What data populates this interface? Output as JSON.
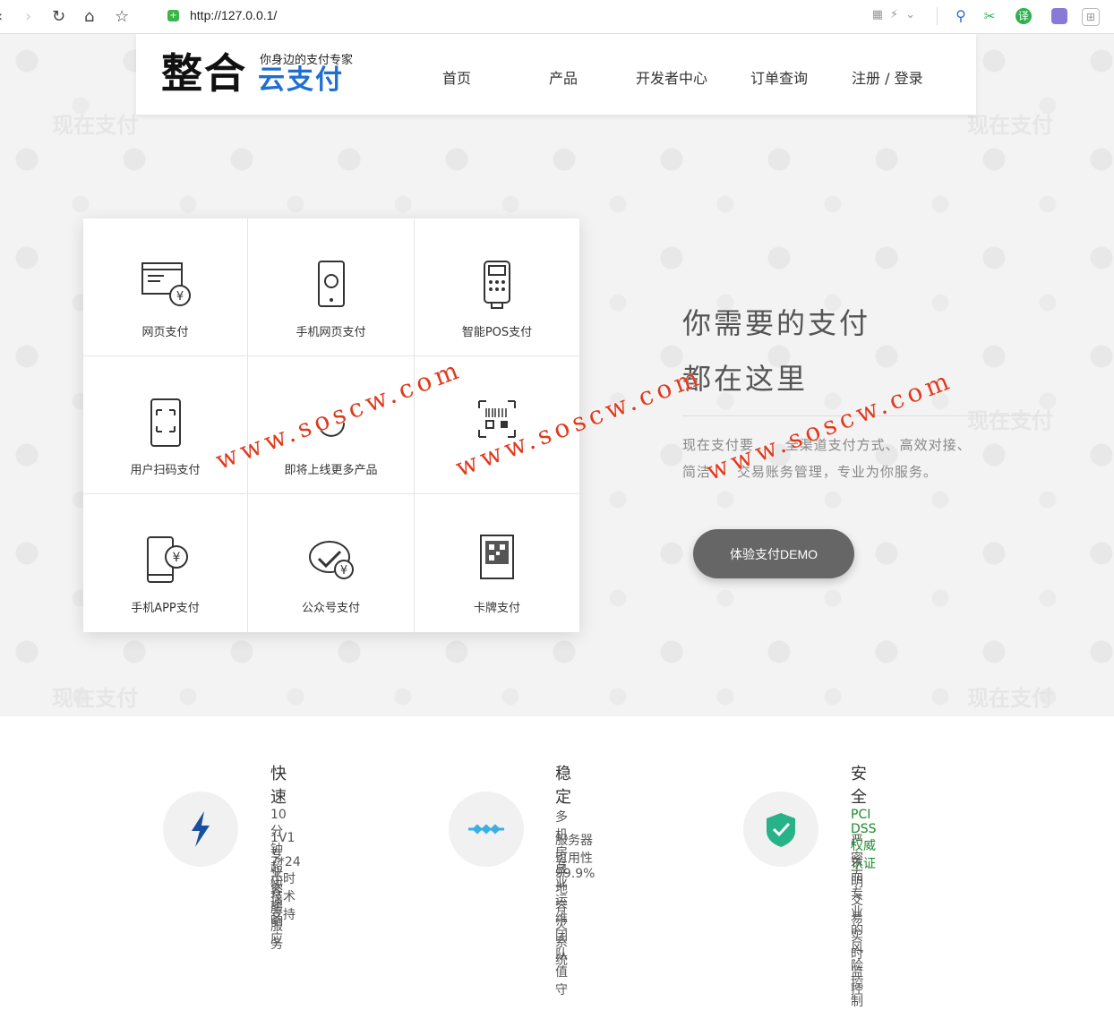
{
  "browser": {
    "url": "http://127.0.0.1/",
    "nav_icons": [
      "back-icon",
      "forward-icon",
      "reload-icon",
      "home-icon",
      "star-icon"
    ],
    "ext_translate_label": "译"
  },
  "site": {
    "logo_main": "整合",
    "logo_sub": "你身边的支付专家",
    "logo_blue": "云支付",
    "nav": [
      "首页",
      "产品",
      "开发者中心",
      "订单查询",
      "注册 / 登录"
    ],
    "brand_color": "#1f6fd0"
  },
  "products": [
    {
      "label": "网页支付",
      "icon": "web-pay-icon"
    },
    {
      "label": "手机网页支付",
      "icon": "mobile-web-pay-icon"
    },
    {
      "label": "智能POS支付",
      "icon": "pos-icon"
    },
    {
      "label": "用户扫码支付",
      "icon": "scan-icon"
    },
    {
      "label": "即将上线更多产品",
      "icon": "more-icon"
    },
    {
      "label": "",
      "icon": "barcode-icon"
    },
    {
      "label": "手机APP支付",
      "icon": "app-pay-icon"
    },
    {
      "label": "公众号支付",
      "icon": "wechat-pay-icon"
    },
    {
      "label": "卡牌支付",
      "icon": "card-pay-icon"
    }
  ],
  "hero": {
    "slogan_line1": "你需要的支付",
    "slogan_line2": "都在这里",
    "desc_line1": "现在支付要      全渠道支付方式、高效对接、",
    "desc_line2": "简洁     交易账务管理，专业为你服务。",
    "demo_button": "体验支付DEMO",
    "bg_logo_text": "现在支付"
  },
  "watermark": "www.soscw.com",
  "features": [
    {
      "title": "快速",
      "items": [
        "10分钟超快速响应",
        "1V1专业客服服务",
        "7*24小时技术支持"
      ],
      "icon": "lightning-icon",
      "color": "#1a4fa0"
    },
    {
      "title": "稳定",
      "items": [
        "多机房异地容灾系统",
        "服务器可用性99.9%",
        "专业运维团队值守"
      ],
      "icon": "stability-icon",
      "color": "#3ab0e2"
    },
    {
      "title": "安全",
      "items": [
        "PCI DSS 权威认证",
        "严密而专业的风险控制",
        "不明交易实时监控"
      ],
      "icon": "shield-check-icon",
      "color": "#27b28a",
      "highlight_color": "#1a8a2a"
    }
  ]
}
